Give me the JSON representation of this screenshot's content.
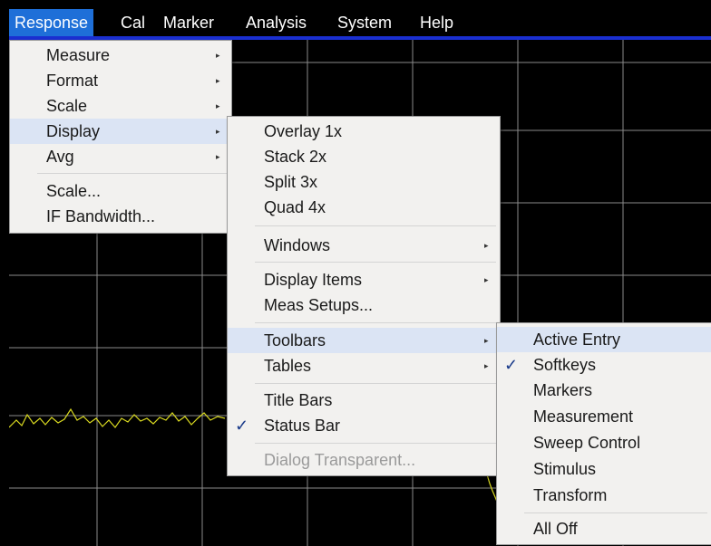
{
  "menubar": {
    "items": [
      "Response",
      "Cal",
      "Marker",
      "Analysis",
      "System",
      "Help"
    ],
    "active": "Response"
  },
  "response_menu": {
    "items": [
      {
        "label": "Measure",
        "submenu": true
      },
      {
        "label": "Format",
        "submenu": true
      },
      {
        "label": "Scale",
        "submenu": true
      },
      {
        "label": "Display",
        "submenu": true,
        "highlighted": true
      },
      {
        "label": "Avg",
        "submenu": true
      },
      {
        "label": "Scale...",
        "submenu": false
      },
      {
        "label": "IF Bandwidth...",
        "submenu": false
      }
    ]
  },
  "display_menu": {
    "items": [
      {
        "label": "Overlay 1x"
      },
      {
        "label": "Stack 2x"
      },
      {
        "label": "Split 3x"
      },
      {
        "label": "Quad 4x"
      },
      {
        "label": "Windows",
        "submenu": true
      },
      {
        "label": "Display Items",
        "submenu": true
      },
      {
        "label": "Meas Setups..."
      },
      {
        "label": "Toolbars",
        "submenu": true,
        "highlighted": true
      },
      {
        "label": "Tables",
        "submenu": true
      },
      {
        "label": "Title Bars"
      },
      {
        "label": "Status Bar",
        "checked": true
      },
      {
        "label": "Dialog Transparent...",
        "disabled": true
      }
    ]
  },
  "toolbars_menu": {
    "items": [
      {
        "label": "Active Entry",
        "highlighted": true
      },
      {
        "label": "Softkeys",
        "checked": true
      },
      {
        "label": "Markers"
      },
      {
        "label": "Measurement"
      },
      {
        "label": "Sweep Control"
      },
      {
        "label": "Stimulus"
      },
      {
        "label": "Transform"
      },
      {
        "label": "All Off"
      }
    ]
  },
  "icons": {
    "submenu_arrow": "▸",
    "checkmark": "✓"
  },
  "colors": {
    "menubar_active": "#1e6fd8",
    "trace": "#d8d820",
    "grid": "#8a8a8a",
    "menu_highlight": "#dbe4f4",
    "header_line": "#1a2fd0"
  }
}
